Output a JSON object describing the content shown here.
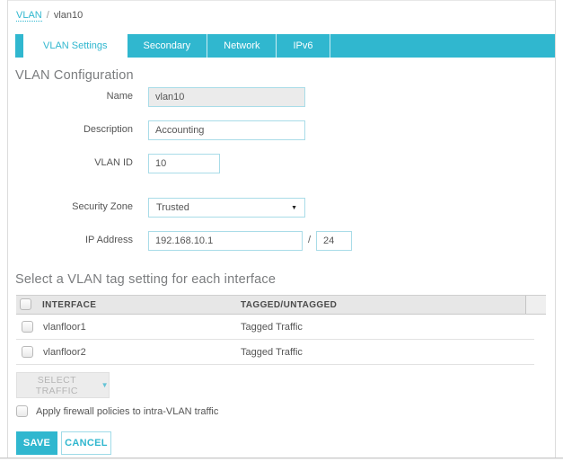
{
  "colors": {
    "accent": "#30b7cf",
    "accent_border": "#a9dce8"
  },
  "breadcrumb": {
    "link": "VLAN",
    "separator": "/",
    "current": "vlan10"
  },
  "tabs": [
    {
      "label": "VLAN Settings",
      "active": true
    },
    {
      "label": "Secondary",
      "active": false
    },
    {
      "label": "Network",
      "active": false
    },
    {
      "label": "IPv6",
      "active": false
    }
  ],
  "page": {
    "title": "VLAN Configuration",
    "section_title": "Select a VLAN tag setting for each interface"
  },
  "form": {
    "name": {
      "label": "Name",
      "value": "vlan10"
    },
    "description": {
      "label": "Description",
      "value": "Accounting"
    },
    "vlan_id": {
      "label": "VLAN ID",
      "value": "10"
    },
    "security_zone": {
      "label": "Security Zone",
      "value": "Trusted"
    },
    "ip_address": {
      "label": "IP Address",
      "value": "192.168.10.1",
      "separator": "/",
      "prefix": "24"
    }
  },
  "table": {
    "headers": {
      "interface": "INTERFACE",
      "tagged": "TAGGED/UNTAGGED"
    },
    "rows": [
      {
        "interface": "vlanfloor1",
        "tagged": "Tagged Traffic"
      },
      {
        "interface": "vlanfloor2",
        "tagged": "Tagged Traffic"
      }
    ]
  },
  "actions": {
    "select_traffic": "SELECT TRAFFIC",
    "apply_label": "Apply firewall policies to intra-VLAN traffic",
    "save": "SAVE",
    "cancel": "CANCEL"
  },
  "icons": {
    "dropdown_arrow": "▼",
    "select_traffic_arrow": "▼"
  }
}
